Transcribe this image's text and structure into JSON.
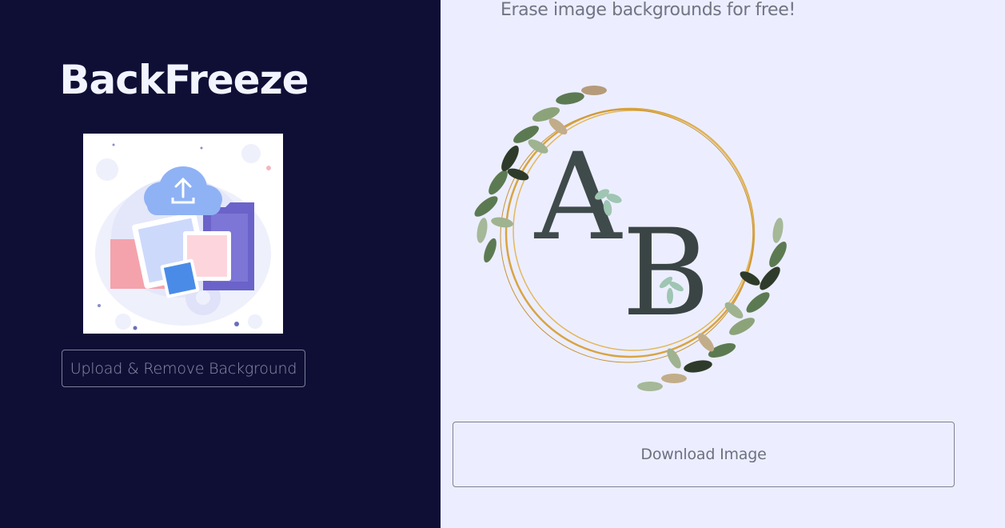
{
  "app": {
    "title": "BackFreeze",
    "tagline": "Erase image backgrounds for free!"
  },
  "left_panel": {
    "illustration_icon": "upload-cloud-illustration",
    "upload_button_label": "Upload & Remove Background"
  },
  "result": {
    "image_letters": {
      "first": "A",
      "second": "B"
    },
    "download_button_label": "Download Image"
  },
  "colors": {
    "sidebar_bg": "#0f0f36",
    "main_bg": "#eceeff",
    "gold_ring": "#d9a441",
    "leaf": "#55704a"
  }
}
